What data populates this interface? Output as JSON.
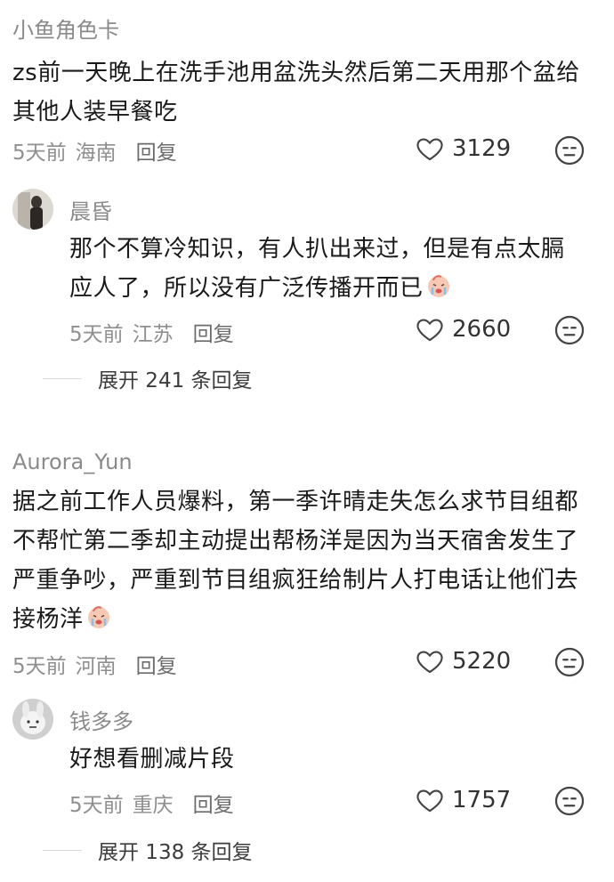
{
  "comments": [
    {
      "username": "小鱼角色卡",
      "text": "zs前一天晚上在洗手池用盆洗头然后第二天用那个盆给其他人装早餐吃",
      "time": "5天前",
      "location": "海南",
      "reply_label": "回复",
      "likes": "3129",
      "replies": [
        {
          "username": "晨昏",
          "text": "那个不算冷知识，有人扒出来过，但是有点太膈应人了，所以没有广泛传播开而已",
          "emoji": "crying-face-emoji",
          "time": "5天前",
          "location": "江苏",
          "reply_label": "回复",
          "likes": "2660"
        }
      ],
      "expand_label": "展开 241 条回复"
    },
    {
      "username": "Aurora_Yun",
      "text": "据之前工作人员爆料，第一季许晴走失怎么求节目组都不帮忙第二季却主动提出帮杨洋是因为当天宿舍发生了严重争吵，严重到节目组疯狂给制片人打电话让他们去接杨洋",
      "emoji": "crying-face-emoji",
      "time": "5天前",
      "location": "河南",
      "reply_label": "回复",
      "likes": "5220",
      "replies": [
        {
          "username": "钱多多",
          "text": "好想看删减片段",
          "time": "5天前",
          "location": "重庆",
          "reply_label": "回复",
          "likes": "1757"
        }
      ],
      "expand_label": "展开 138 条回复"
    }
  ],
  "icons": {
    "like": "heart-outline-icon",
    "dislike": "neutral-face-icon"
  },
  "colors": {
    "background": "#ffffff",
    "username": "#8a8a8a",
    "text": "#1a1a1a",
    "meta": "#8f8f8f"
  }
}
